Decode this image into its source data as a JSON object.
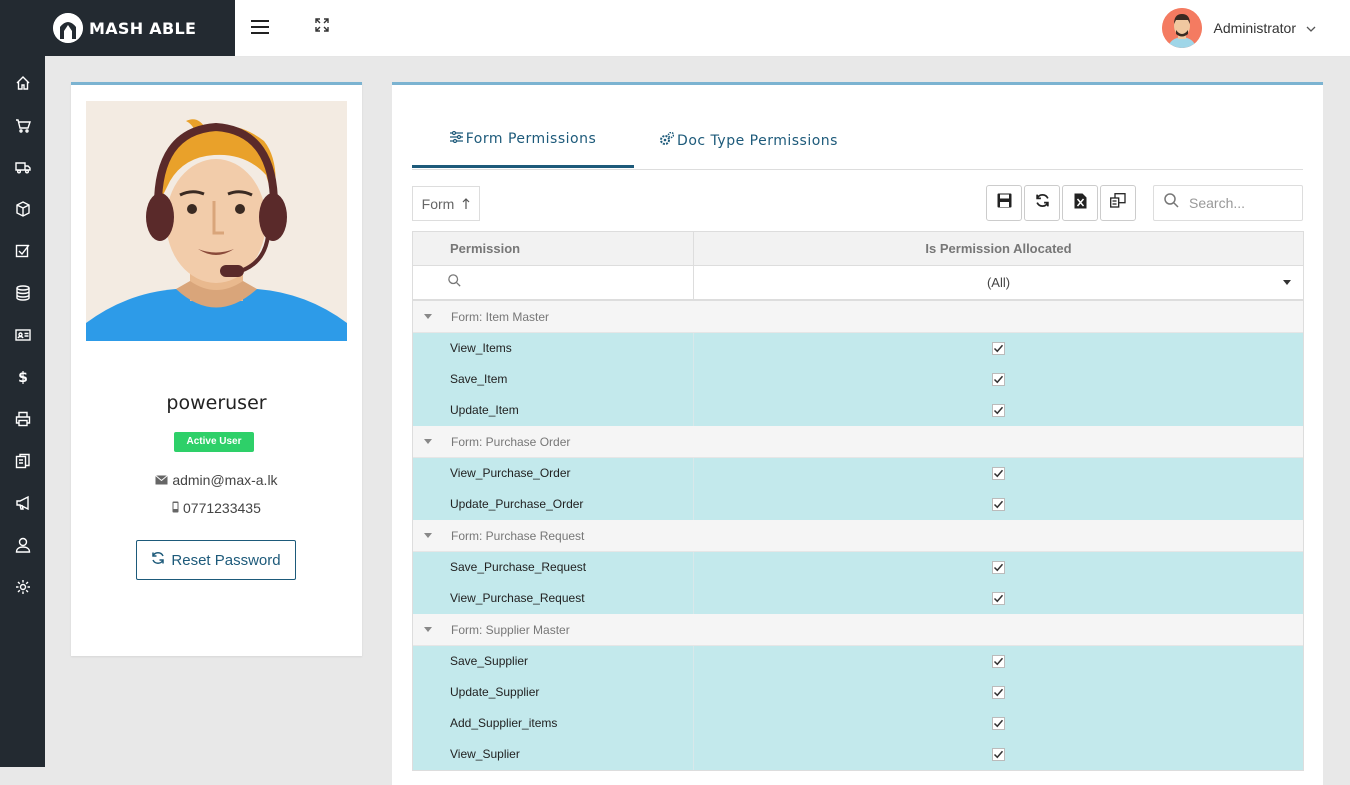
{
  "brand": {
    "name": "MASH ABLE"
  },
  "header": {
    "user_name": "Administrator"
  },
  "sidebar": {
    "icons": [
      "home-icon",
      "cart-icon",
      "truck-icon",
      "box-icon",
      "checklist-icon",
      "database-icon",
      "id-card-icon",
      "dollar-icon",
      "printer-icon",
      "documents-icon",
      "megaphone-icon",
      "user-icon",
      "gear-icon"
    ]
  },
  "profile": {
    "username": "poweruser",
    "status_badge": "Active User",
    "email": "admin@max-a.lk",
    "phone": "0771233435",
    "reset_label": "Reset Password"
  },
  "tabs": [
    {
      "label": "Form Permissions",
      "active": true
    },
    {
      "label": "Doc Type Permissions",
      "active": false
    }
  ],
  "toolbar": {
    "sort_label": "Form",
    "search_placeholder": "Search..."
  },
  "grid": {
    "columns": [
      "Permission",
      "Is Permission Allocated"
    ],
    "filter_value": "(All)",
    "groups": [
      {
        "label": "Form: Item Master",
        "rows": [
          {
            "name": "View_Items",
            "allocated": true
          },
          {
            "name": "Save_Item",
            "allocated": true
          },
          {
            "name": "Update_Item",
            "allocated": true
          }
        ]
      },
      {
        "label": "Form: Purchase Order",
        "rows": [
          {
            "name": "View_Purchase_Order",
            "allocated": true
          },
          {
            "name": "Update_Purchase_Order",
            "allocated": true
          }
        ]
      },
      {
        "label": "Form: Purchase Request",
        "rows": [
          {
            "name": "Save_Purchase_Request",
            "allocated": true
          },
          {
            "name": "View_Purchase_Request",
            "allocated": true
          }
        ]
      },
      {
        "label": "Form: Supplier Master",
        "rows": [
          {
            "name": "Save_Supplier",
            "allocated": true
          },
          {
            "name": "Update_Supplier",
            "allocated": true
          },
          {
            "name": "Add_Supplier_items",
            "allocated": true
          },
          {
            "name": "View_Suplier",
            "allocated": true
          }
        ]
      }
    ]
  },
  "colors": {
    "sidebar": "#232a31",
    "accent": "#1d5a7a",
    "row_selected": "#c3e9ec",
    "badge": "#2ed069"
  }
}
